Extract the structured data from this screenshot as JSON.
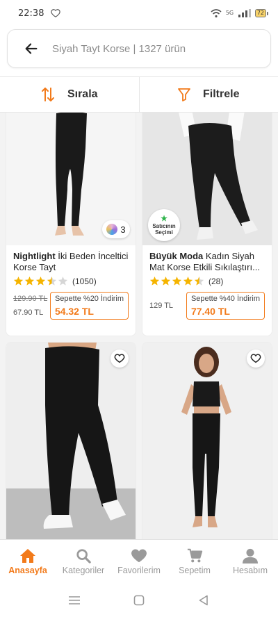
{
  "status_bar": {
    "time": "22:38",
    "battery": "72",
    "network": "5G"
  },
  "search": {
    "text": "Siyah Tayt Korse | 1327 ürün",
    "icon": "back-arrow-icon"
  },
  "toolbar": {
    "sort_label": "Sırala",
    "filter_label": "Filtrele",
    "accent_color": "#f27a1a"
  },
  "products": [
    {
      "brand": "Nightlight",
      "name": " İki Beden İnceltici Korse Tayt",
      "rating": 3.5,
      "review_count": "(1050)",
      "old_price": "129.90 TL",
      "price": "67.90 TL",
      "discount_label": "Sepette %20 İndirim",
      "discount_price": "54.32 TL",
      "color_count": "3"
    },
    {
      "brand": "Büyük Moda",
      "name": " Kadın Siyah Mat Korse Etkili Sıkılaştırı...",
      "rating": 4.5,
      "review_count": "(28)",
      "price": "129 TL",
      "discount_label": "Sepette %40 İndirim",
      "discount_price": "77.40 TL",
      "seller_badge_line1": "Satıcının",
      "seller_badge_line2": "Seçimi"
    },
    {
      "favorite": false
    },
    {
      "favorite": false
    }
  ],
  "bottom_nav": [
    {
      "label": "Anasayfa",
      "icon": "home-icon",
      "active": true
    },
    {
      "label": "Kategoriler",
      "icon": "search-icon",
      "active": false
    },
    {
      "label": "Favorilerim",
      "icon": "heart-icon",
      "active": false
    },
    {
      "label": "Sepetim",
      "icon": "cart-icon",
      "active": false
    },
    {
      "label": "Hesabım",
      "icon": "user-icon",
      "active": false
    }
  ],
  "colors": {
    "accent": "#f27a1a",
    "star": "#f5b400",
    "inactive": "#9a9a9a"
  }
}
